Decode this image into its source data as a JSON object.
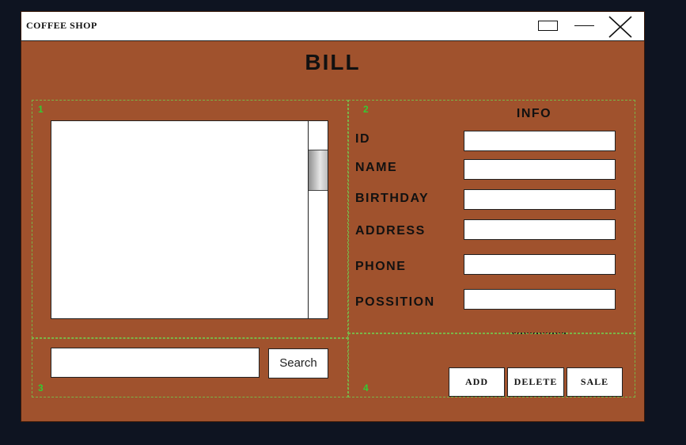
{
  "window": {
    "title": "COFFEE SHOP"
  },
  "header": {
    "title": "BILL"
  },
  "regions": {
    "r1": "1",
    "r2": "2",
    "r3": "3",
    "r4": "4"
  },
  "search": {
    "button_label": "Search",
    "value": ""
  },
  "info": {
    "title": "INFO",
    "fields": [
      {
        "label": "ID",
        "value": ""
      },
      {
        "label": "NAME",
        "value": ""
      },
      {
        "label": "BIRTHDAY",
        "value": ""
      },
      {
        "label": "ADDRESS",
        "value": ""
      },
      {
        "label": "PHONE",
        "value": ""
      },
      {
        "label": "POSSITION",
        "value": ""
      }
    ]
  },
  "actions": {
    "add": "ADD",
    "delete": "DELETE",
    "sale": "SALE"
  },
  "colors": {
    "background": "#0e1421",
    "window": "#a0522d",
    "region_border": "#7ab648",
    "region_number": "#33cc33"
  },
  "icons": {
    "maximize": "maximize-icon",
    "minimize": "minimize-icon",
    "close": "close-icon"
  }
}
